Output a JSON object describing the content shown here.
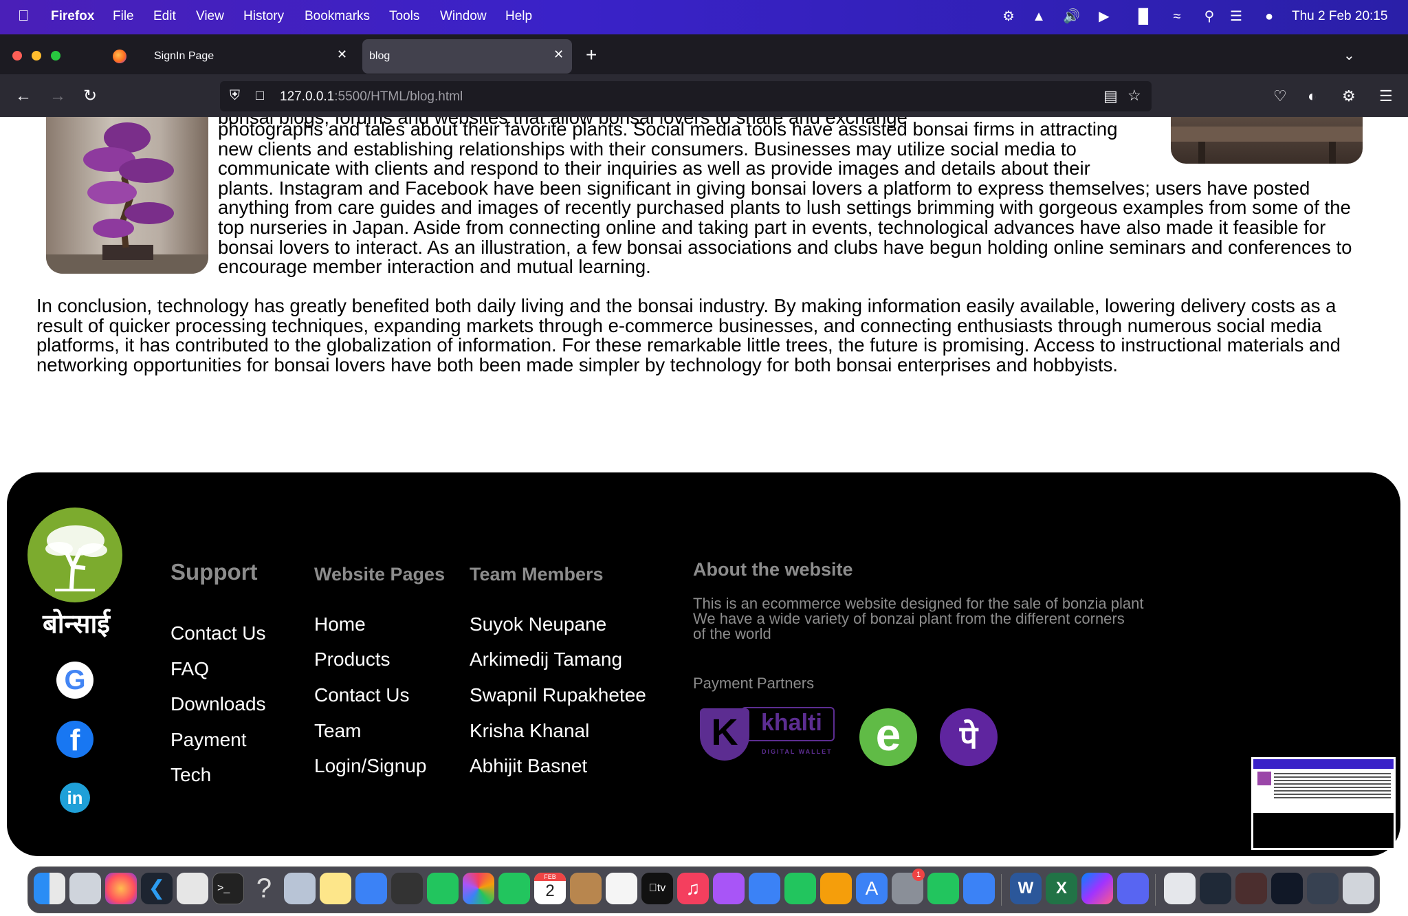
{
  "menubar": {
    "app": "Firefox",
    "items": [
      "File",
      "Edit",
      "View",
      "History",
      "Bookmarks",
      "Tools",
      "Window",
      "Help"
    ],
    "datetime": "Thu 2 Feb  20:15"
  },
  "tabs": [
    {
      "label": "SignIn Page",
      "active": false
    },
    {
      "label": "blog",
      "active": true
    }
  ],
  "url": {
    "host": "127.0.0.1",
    "path": ":5500/HTML/blog.html"
  },
  "article": {
    "para1_lines": [
      "photographs and tales about their favorite plants. Social media tools have assisted bonsai firms in attracting",
      "new clients and establishing relationships with their consumers. Businesses may utilize social media to",
      "communicate with clients and respond to their inquiries as well as provide images and details about their",
      "plants. Instagram and Facebook have been significant in giving bonsai lovers a platform to express themselves; users have posted",
      "anything from care guides and images of recently purchased plants to lush settings brimming with gorgeous examples from some of the",
      "top nurseries in Japan. Aside from connecting online and taking part in events, technological advances have also made it feasible for",
      "bonsai lovers to interact. As an illustration, a few bonsai associations and clubs have begun holding online seminars and conferences to",
      "encourage member interaction and mutual learning."
    ],
    "para2_lines": [
      "In conclusion, technology has greatly benefited both daily living and the bonsai industry. By making information easily available, lowering delivery costs as a",
      "result of quicker processing techniques, expanding markets through e-commerce businesses, and connecting enthusiasts through numerous social media",
      "platforms, it has contributed to the globalization of information. For these remarkable little trees, the future is promising. Access to instructional materials and",
      "networking opportunities for bonsai lovers have both been made simpler by technology for both bonsai enterprises and hobbyists."
    ]
  },
  "footer": {
    "logo_text": "बोन्साई",
    "support": {
      "heading": "Support",
      "links": [
        "Contact Us",
        "FAQ",
        "Downloads",
        "Payment",
        "Tech"
      ]
    },
    "pages": {
      "heading": "Website Pages",
      "links": [
        "Home",
        "Products",
        "Contact Us",
        "Team",
        "Login/Signup"
      ]
    },
    "team": {
      "heading": "Team Members",
      "links": [
        "Suyok Neupane",
        "Arkimedij Tamang",
        "Swapnil Rupakhetee",
        "Krisha Khanal",
        "Abhijit Basnet"
      ]
    },
    "about": {
      "heading": "About the website",
      "lines": [
        "This is an ecommerce website designed for the sale of bonzia plant",
        "We have a wide variety of bonzai plant from the different corners",
        "of the world"
      ]
    },
    "payment": {
      "heading": "Payment Partners",
      "khalti_k": "K",
      "khalti_name": "khalti",
      "khalti_sub": "DIGITAL WALLET",
      "esewa": "e",
      "phonepe": "पे"
    },
    "social": {
      "google": "G",
      "facebook": "f",
      "linkedin": "in"
    }
  },
  "dock": {
    "calendar_month": "FEB",
    "calendar_day": "2",
    "badge": "1"
  },
  "colors": {
    "logo_green": "#7cab2e",
    "khalti_purple": "#5c2d91",
    "esewa_green": "#60bb46",
    "phonepe_purple": "#5f259f"
  }
}
